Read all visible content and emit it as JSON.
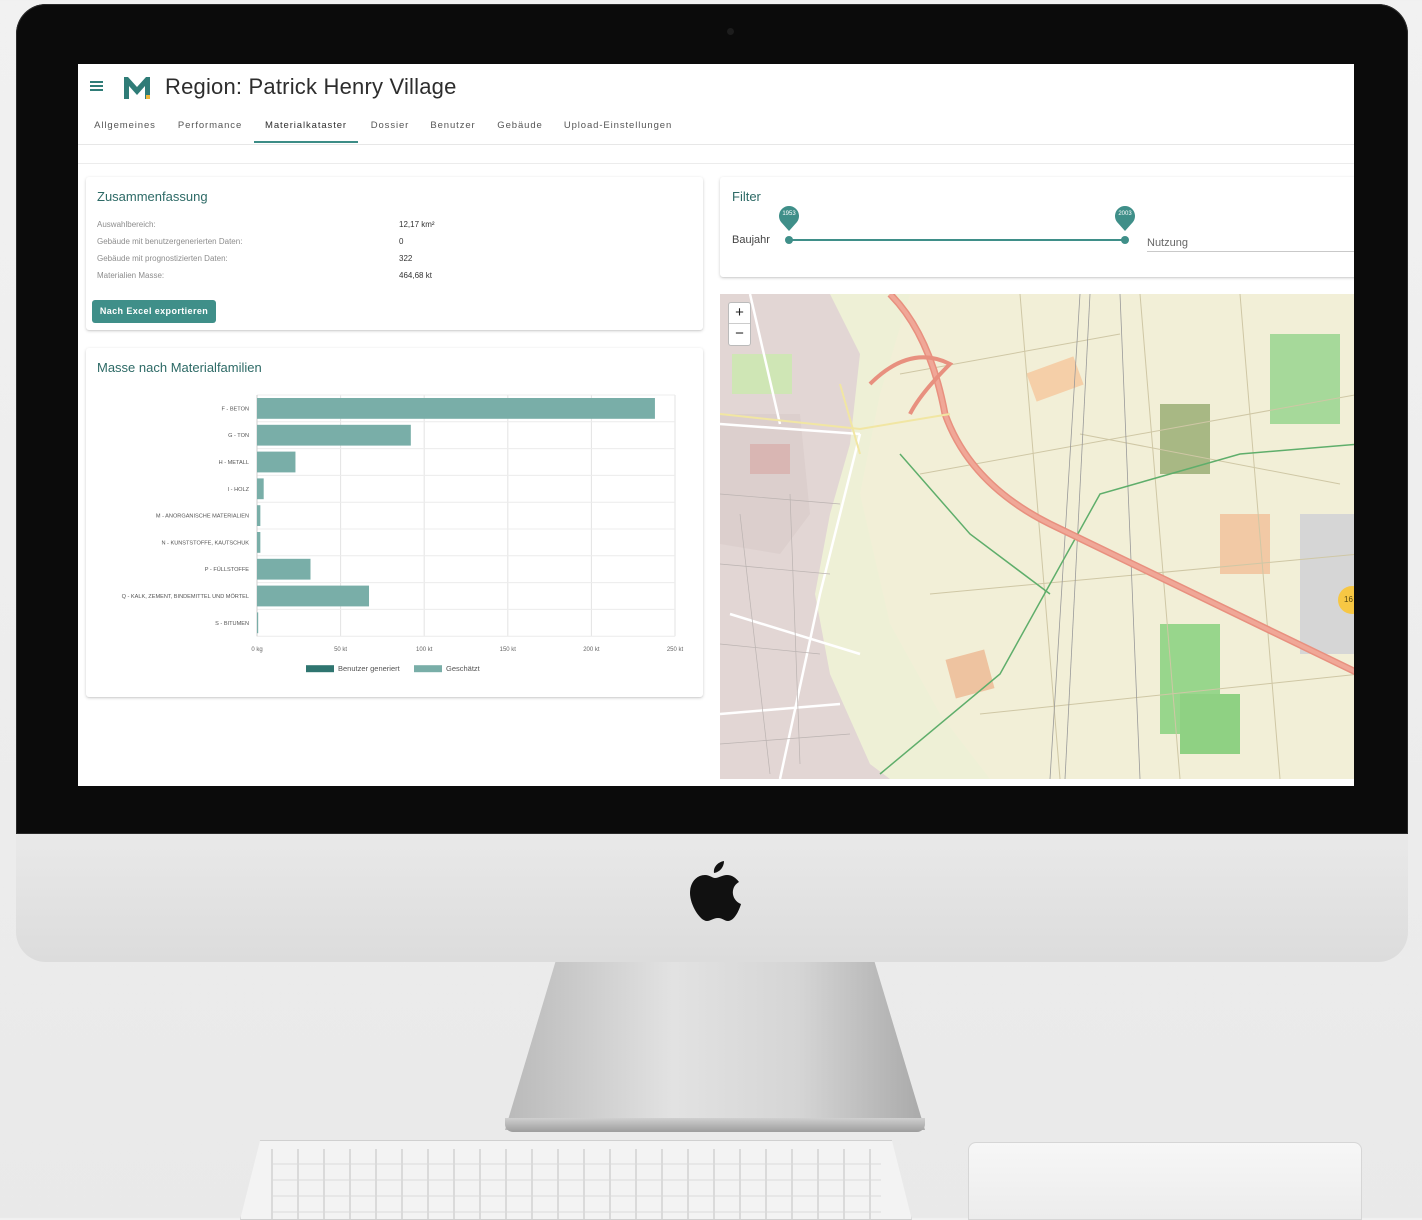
{
  "app": {
    "title": "Region: Patrick Henry Village"
  },
  "tabs": [
    {
      "label": "Allgemeines"
    },
    {
      "label": "Performance"
    },
    {
      "label": "Materialkataster",
      "active": true
    },
    {
      "label": "Dossier"
    },
    {
      "label": "Benutzer"
    },
    {
      "label": "Gebäude"
    },
    {
      "label": "Upload-Einstellungen"
    }
  ],
  "summary": {
    "title": "Zusammenfassung",
    "rows": [
      {
        "label": "Auswahlbereich:",
        "value": "12,17 km²"
      },
      {
        "label": "Gebäude mit benutzergenerierten Daten:",
        "value": "0"
      },
      {
        "label": "Gebäude mit prognostizierten Daten:",
        "value": "322"
      },
      {
        "label": "Materialien Masse:",
        "value": "464,68 kt"
      }
    ],
    "export_label": "Nach Excel exportieren"
  },
  "filter": {
    "title": "Filter",
    "baujahr_label": "Baujahr",
    "range_min_label": "1953",
    "range_max_label": "2003",
    "nutzung_label": "Nutzung"
  },
  "map": {
    "zoom_in": "+",
    "zoom_out": "−",
    "cluster_label": "16"
  },
  "colors": {
    "accent": "#3f8f89",
    "user_generated": "#2f7570",
    "estimated": "#79aea8"
  },
  "chart_data": {
    "type": "bar",
    "orientation": "horizontal",
    "title": "Masse nach Materialfamilien",
    "categories": [
      "F - BETON",
      "G - TON",
      "H - METALL",
      "I - HOLZ",
      "M - ANORGANISCHE MATERIALIEN",
      "N - KUNSTSTOFFE, KAUTSCHUK",
      "P - FÜLLSTOFFE",
      "Q - KALK, ZEMENT, BINDEMITTEL UND MÖRTEL",
      "S - BITUMEN"
    ],
    "series": [
      {
        "name": "Benutzer generiert",
        "values": [
          0,
          0,
          0,
          0,
          0,
          0,
          0,
          0,
          0
        ]
      },
      {
        "name": "Geschätzt",
        "values": [
          238,
          92,
          23,
          4,
          2,
          2,
          32,
          67,
          0.5
        ]
      }
    ],
    "xlim": [
      0,
      250
    ],
    "x_ticks": [
      "0 kg",
      "50 kt",
      "100 kt",
      "150 kt",
      "200 kt",
      "250 kt"
    ],
    "grid": true,
    "legend_position": "bottom"
  }
}
